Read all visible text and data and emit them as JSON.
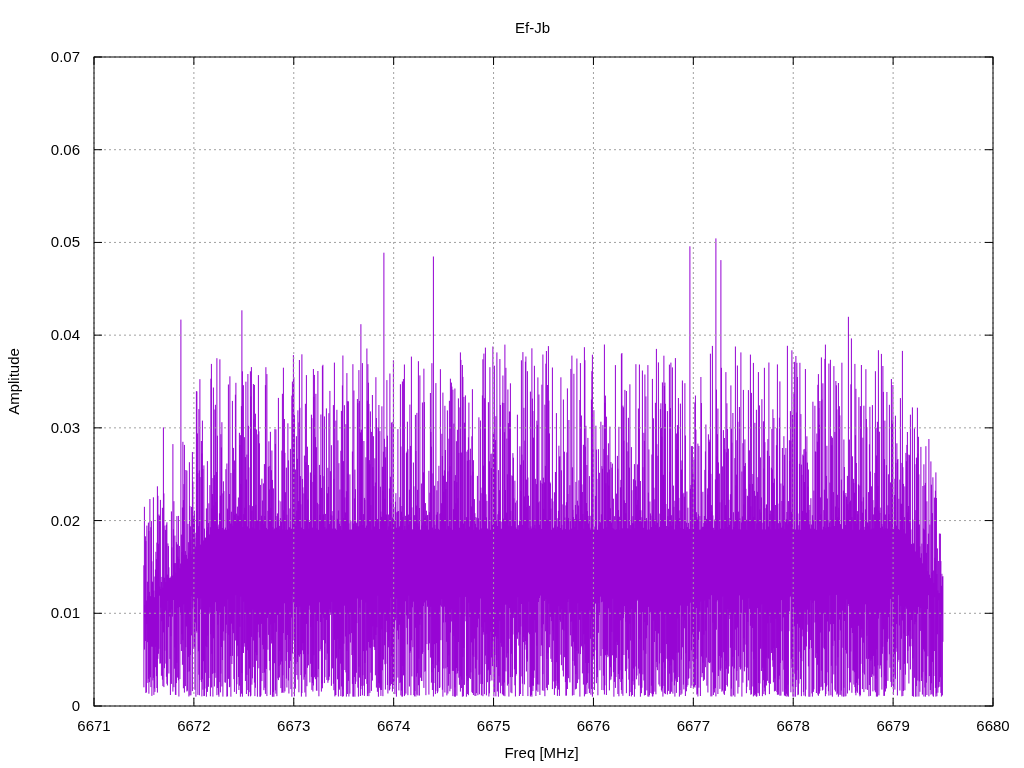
{
  "chart_data": {
    "type": "line",
    "title": "Ef-Jb",
    "xlabel": "Freq [MHz]",
    "ylabel": "Amplitude",
    "xlim": [
      6671,
      6680
    ],
    "ylim": [
      0,
      0.07
    ],
    "grid": true,
    "xticks": [
      6671,
      6672,
      6673,
      6674,
      6675,
      6676,
      6677,
      6678,
      6679,
      6680
    ],
    "yticks": [
      0,
      0.01,
      0.02,
      0.03,
      0.04,
      0.05,
      0.06,
      0.07
    ]
  }
}
